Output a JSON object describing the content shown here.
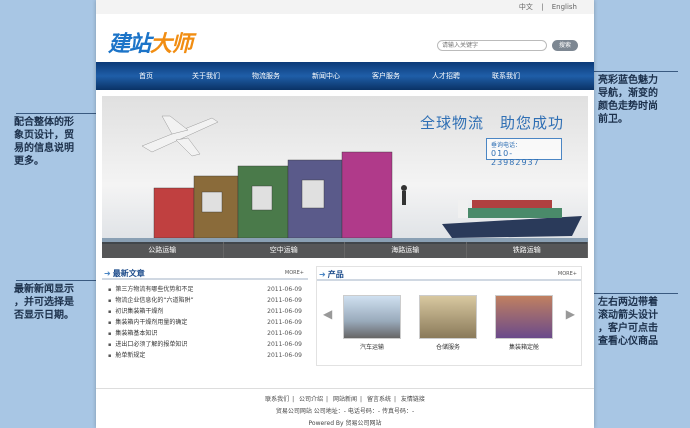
{
  "annotations": {
    "left_top": [
      "配合整体的形",
      "象页设计，贸",
      "易的信息说明",
      "更多。"
    ],
    "left_bottom": [
      "最新新闻显示",
      "，并可选择是",
      "否显示日期。"
    ],
    "right_top": [
      "亮彩蓝色魅力",
      "导航，渐变的",
      "颜色走势时尚",
      "前卫。"
    ],
    "right_bottom": [
      "左右两边带着",
      "滚动箭头设计",
      "，客户可点击",
      "查看心仪商品"
    ]
  },
  "topbar": {
    "lang_cn": "中文",
    "sep": "|",
    "lang_en": "English"
  },
  "logo": {
    "part_a": "建站",
    "part_b": "大师"
  },
  "search": {
    "placeholder": "请输入关键字",
    "button": "搜索"
  },
  "nav": [
    "首页",
    "关于我们",
    "物流服务",
    "新闻中心",
    "客户服务",
    "人才招聘",
    "联系我们"
  ],
  "banner": {
    "slogan": "全球物流　助您成功",
    "hotline_label": "垂询电话：",
    "hotline_number": "010-23982937",
    "tabs": [
      "公路运输",
      "空中运输",
      "海路运输",
      "铁路运输"
    ]
  },
  "news": {
    "title": "最新文章",
    "more": "MORE+",
    "items": [
      {
        "t": "第三方物流有哪些优势和不足",
        "d": "2011-06-09"
      },
      {
        "t": "物流企业信息化的“六道陷阱”",
        "d": "2011-06-09"
      },
      {
        "t": "初识集装箱干燥剂",
        "d": "2011-06-09"
      },
      {
        "t": "集装箱内干燥剂用量的确定",
        "d": "2011-06-09"
      },
      {
        "t": "集装箱基本知识",
        "d": "2011-06-09"
      },
      {
        "t": "进出口必须了解的报单知识",
        "d": "2011-06-09"
      },
      {
        "t": "舱单新规定",
        "d": "2011-06-09"
      }
    ]
  },
  "products": {
    "title": "产品",
    "more": "MORE+",
    "items": [
      "汽车运输",
      "仓储服务",
      "集装箱定舱"
    ]
  },
  "footer": {
    "links": [
      "联系我们",
      "公司介绍",
      "网站新闻",
      "留言系统",
      "友情链接"
    ],
    "info": "贸易公司网站  公司地址：- 电话号码：- 传真号码：-",
    "power": "Powered By 贸易公司网站"
  },
  "colors": {
    "nav_blue": "#1f5ea8",
    "accent_blue": "#2f6fb4",
    "background": "#a8c6e4"
  }
}
